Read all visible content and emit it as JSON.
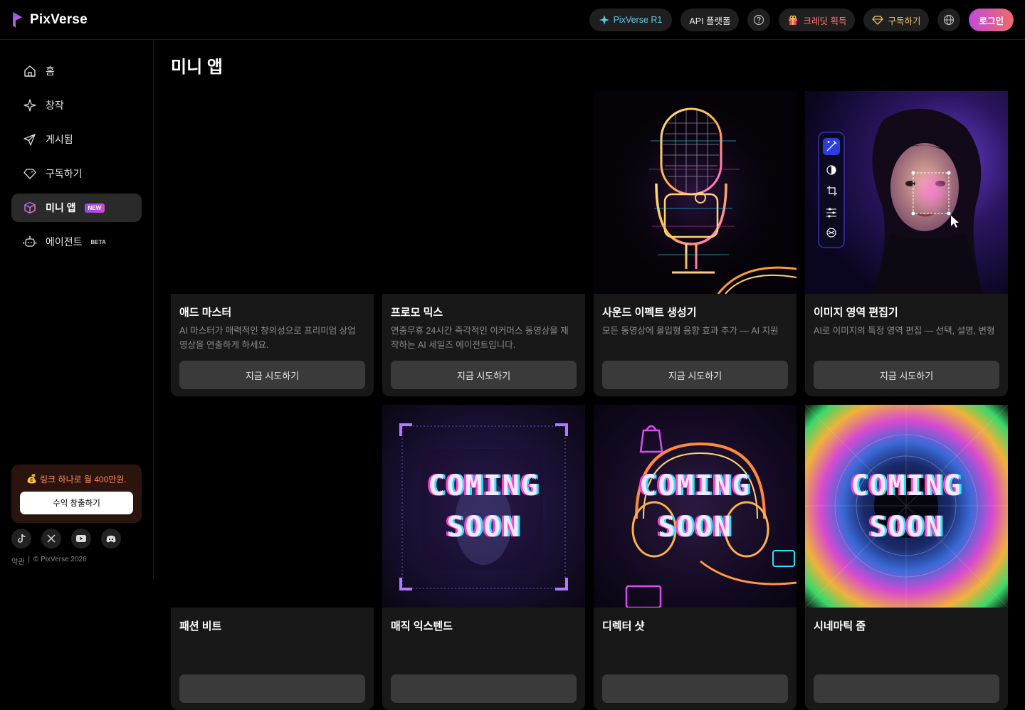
{
  "app": {
    "name": "PixVerse"
  },
  "header": {
    "r1_label": "PixVerse R1",
    "api_label": "API 플랫폼",
    "credits_label": "크레딧 획득",
    "subscribe_label": "구독하기",
    "login_label": "로그인",
    "help_icon": "question-circle-icon",
    "language_icon": "globe-icon"
  },
  "sidebar": {
    "items": [
      {
        "label": "홈",
        "icon": "home-icon"
      },
      {
        "label": "창작",
        "icon": "sparkle-icon"
      },
      {
        "label": "게시됨",
        "icon": "send-icon"
      },
      {
        "label": "구독하기",
        "icon": "diamond-icon"
      },
      {
        "label": "미니 앱",
        "icon": "cube-icon",
        "badge": "NEW",
        "active": true
      },
      {
        "label": "에이전트",
        "icon": "robot-icon",
        "badge": "BETA"
      }
    ],
    "promo_text": "링크 하나로 월 400만원.",
    "promo_button": "수익 창출하기",
    "socials": [
      "tiktok-icon",
      "x-icon",
      "youtube-icon",
      "discord-icon"
    ],
    "footer_terms": "약관",
    "footer_sep": "|",
    "footer_copyright": "© PixVerse 2026"
  },
  "main": {
    "title": "미니 앱",
    "cards": [
      {
        "title": "애드 마스터",
        "desc": "AI 마스터가 매력적인 창의성으로 프리미엄 상업 영상을 연출하게 하세요.",
        "button": "지금 시도하기",
        "media": "blank"
      },
      {
        "title": "프로모 믹스",
        "desc": "연중무휴 24시간 즉각적인 이커머스 동영상을 제작하는 AI 세일즈 에이전트입니다.",
        "button": "지금 시도하기",
        "media": "blank"
      },
      {
        "title": "사운드 이펙트 생성기",
        "desc": "모든 동영상에 몰입형 음향 효과 추가 — AI 지원",
        "button": "지금 시도하기",
        "media": "microphone"
      },
      {
        "title": "이미지 영역 편집기",
        "desc": "AI로 이미지의 특정 영역 편집 — 선택, 설명, 변형",
        "button": "지금 시도하기",
        "media": "portrait"
      },
      {
        "title": "패션 비트",
        "desc": "",
        "button": "",
        "media": "blank"
      },
      {
        "title": "매직 익스텐드",
        "desc": "",
        "button": "",
        "media": "coming-soon",
        "coming_line1": "COMING",
        "coming_line2": "SOON"
      },
      {
        "title": "디렉터 샷",
        "desc": "",
        "button": "",
        "media": "coming-soon",
        "coming_line1": "COMING",
        "coming_line2": "SOON"
      },
      {
        "title": "시네마틱 줌",
        "desc": "",
        "button": "",
        "media": "coming-soon",
        "coming_line1": "COMING",
        "coming_line2": "SOON"
      }
    ]
  },
  "colors": {
    "accent": "#c04bd8",
    "r1": "#63c7e8",
    "credits": "#ff7a7a",
    "subscribe": "#f3c36a",
    "promo": "#ff8a5c"
  }
}
